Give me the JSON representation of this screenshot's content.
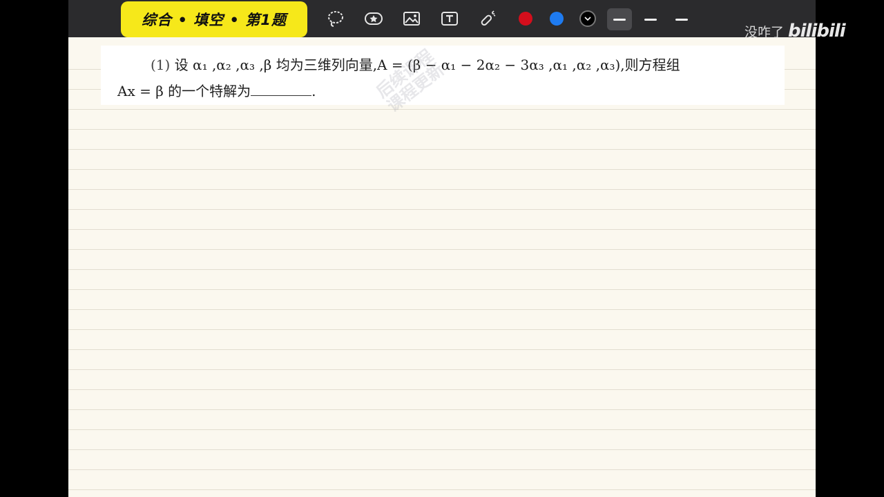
{
  "toolbar": {
    "title": "综合 • 填空 • 第1题",
    "tools": [
      {
        "name": "lasso-icon"
      },
      {
        "name": "sticker-icon"
      },
      {
        "name": "image-icon"
      },
      {
        "name": "text-box-icon"
      },
      {
        "name": "laser-pointer-icon"
      }
    ],
    "colors": [
      "#d40e1c",
      "#1e7bf0",
      "#000000"
    ],
    "stroke_widths": [
      "thin",
      "medium",
      "thick"
    ]
  },
  "question": {
    "number": "(1)",
    "line1": "设 α₁ ,α₂ ,α₃ ,β 均为三维列向量,A = (β − α₁ − 2α₂ − 3α₃ ,α₁ ,α₂ ,α₃),则方程组",
    "line2_prefix": "Ax = β 的一个特解为",
    "line2_suffix": "."
  },
  "watermark": {
    "line1": "后续课程",
    "line2": "课程更新"
  },
  "branding": {
    "uploader": "没咋了",
    "logo": "bilibili"
  }
}
